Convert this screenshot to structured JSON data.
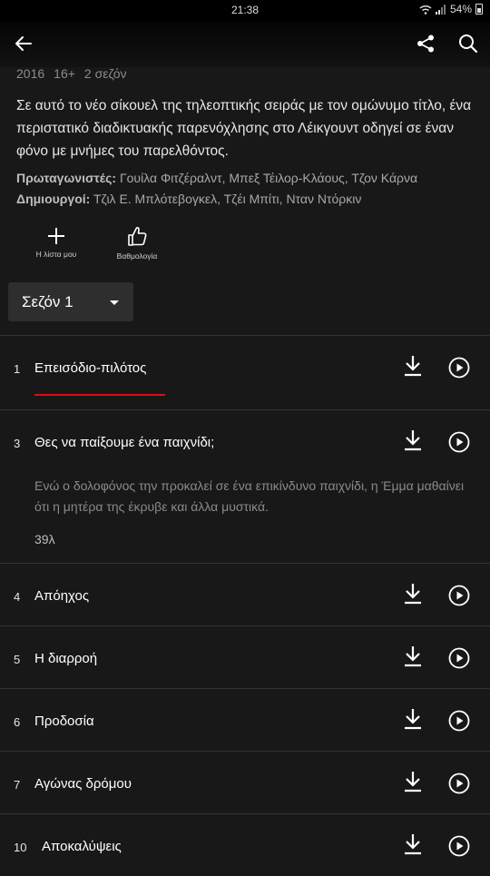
{
  "status_bar": {
    "time": "21:38",
    "battery": "54%"
  },
  "show": {
    "year": "2016",
    "rating": "16+",
    "seasons": "2 σεζόν",
    "synopsis": "Σε αυτό το νέο σίκουελ της τηλεοπτικής σειράς με τον ομώνυμο τίτλο, ένα περιστατικό διαδικτυακής παρενόχλησης στο Λέικγουντ οδηγεί σε έναν φόνο με μνήμες του παρελθόντος.",
    "cast_label": "Πρωταγωνιστές:",
    "cast": "Γουίλα Φιτζέραλντ, Μπεξ Τέιλορ-Κλάους, Τζον Κάρνα",
    "creators_label": "Δημιουργοί:",
    "creators": "Τζιλ Ε. Μπλότεβογκελ, Τζέι Μπίτι, Νταν Ντόρκιν"
  },
  "actions": {
    "my_list": "Η λίστα μου",
    "rate": "Βαθμολογία"
  },
  "season_selector": {
    "selected": "Σεζόν 1"
  },
  "episodes": [
    {
      "number": "1",
      "title": "Επεισόδιο-πιλότος"
    },
    {
      "number": "3",
      "title": "Θες να παίξουμε ένα παιχνίδι;",
      "description": "Ενώ ο δολοφόνος την προκαλεί σε ένα επικίνδυνο παιχνίδι, η Έμμα μαθαίνει ότι η μητέρα της έκρυβε και άλλα μυστικά.",
      "duration": "39λ"
    },
    {
      "number": "4",
      "title": "Απόηχος"
    },
    {
      "number": "5",
      "title": "Η διαρροή"
    },
    {
      "number": "6",
      "title": "Προδοσία"
    },
    {
      "number": "7",
      "title": "Αγώνας δρόμου"
    },
    {
      "number": "10",
      "title": "Αποκαλύψεις"
    }
  ],
  "colors": {
    "accent_red": "#e50914",
    "background": "#181818"
  }
}
